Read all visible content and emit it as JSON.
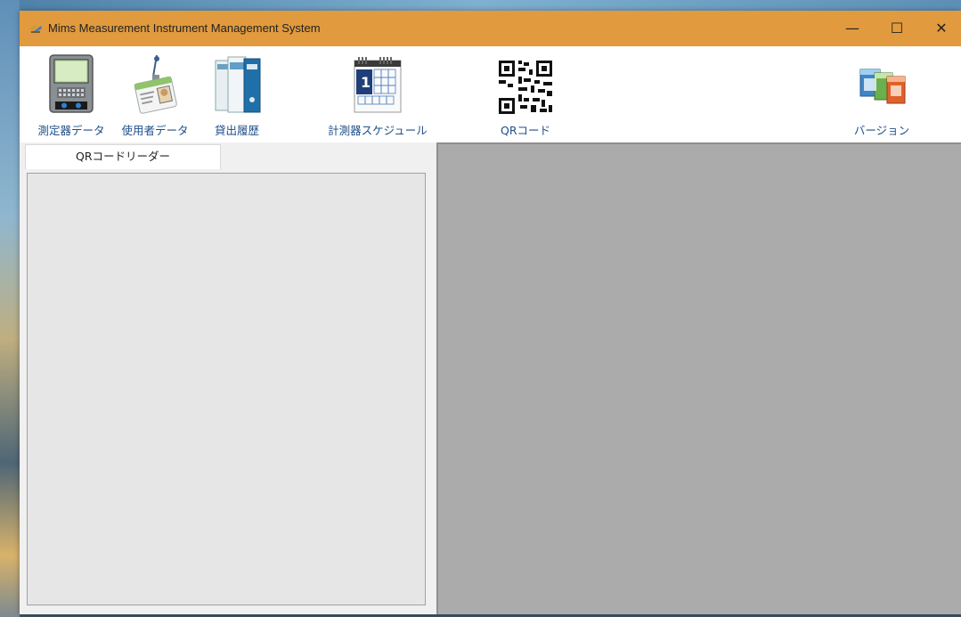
{
  "window": {
    "title": "Mims  Measurement Instrument Management System",
    "controls": {
      "minimize": "—",
      "maximize": "☐",
      "close": "✕"
    },
    "titlebar_color": "#e19a3d"
  },
  "toolbar": {
    "items": [
      {
        "label": "測定器データ",
        "icon": "measuring-instrument-icon"
      },
      {
        "label": "使用者データ",
        "icon": "id-badge-icon"
      },
      {
        "label": "貸出履歴",
        "icon": "binders-icon"
      },
      {
        "label": "計測器スケジュール",
        "icon": "calendar-icon"
      },
      {
        "label": "QRコード",
        "icon": "qr-code-icon"
      },
      {
        "label": "バージョン",
        "icon": "software-boxes-icon"
      }
    ]
  },
  "left_panel": {
    "tab_label": "QRコードリーダー"
  },
  "colors": {
    "right_panel_bg": "#ababab",
    "left_panel_bg": "#e6e6e6"
  }
}
